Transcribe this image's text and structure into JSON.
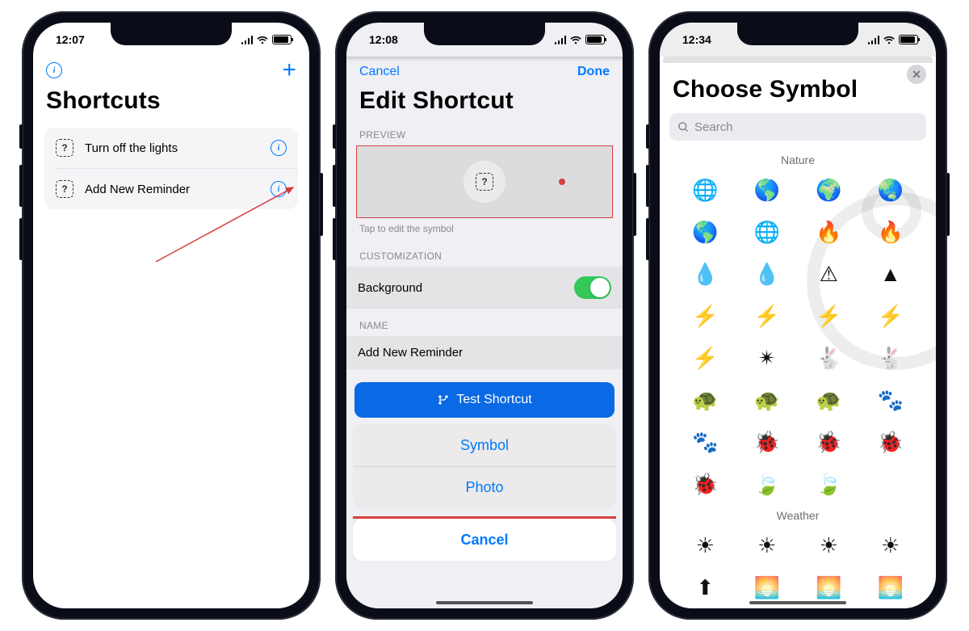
{
  "phone1": {
    "time": "12:07",
    "title": "Shortcuts",
    "rows": [
      {
        "label": "Turn off the lights"
      },
      {
        "label": "Add New Reminder"
      }
    ]
  },
  "phone2": {
    "time": "12:08",
    "nav": {
      "cancel": "Cancel",
      "done": "Done"
    },
    "title": "Edit Shortcut",
    "section_preview": "PREVIEW",
    "hint": "Tap to edit the symbol",
    "section_customization": "CUSTOMIZATION",
    "background_label": "Background",
    "section_name": "NAME",
    "name_value": "Add New Reminder",
    "test_button": "Test Shortcut",
    "sheet": {
      "symbol": "Symbol",
      "photo": "Photo",
      "cancel": "Cancel"
    }
  },
  "phone3": {
    "time": "12:34",
    "title": "Choose Symbol",
    "search_placeholder": "Search",
    "cat_nature": "Nature",
    "cat_weather": "Weather",
    "icons_nature": [
      "🌐",
      "🌎",
      "🌍",
      "🌏",
      "🌎",
      "🌐",
      "🔥",
      "🔥",
      "💧",
      "💧",
      "⚠",
      "▲",
      "⚡",
      "⚡",
      "⚡",
      "⚡",
      "⚡",
      "✴",
      "🐇",
      "🐇",
      "🐢",
      "🐢",
      "🐢",
      "🐾",
      "🐾",
      "🐞",
      "🐞",
      "🐞",
      "🐞",
      "🍃",
      "🍃",
      ""
    ],
    "icons_weather": [
      "☀",
      "☀",
      "☀",
      "☀",
      "⬆",
      "🌅",
      "🌅",
      "🌅"
    ]
  }
}
